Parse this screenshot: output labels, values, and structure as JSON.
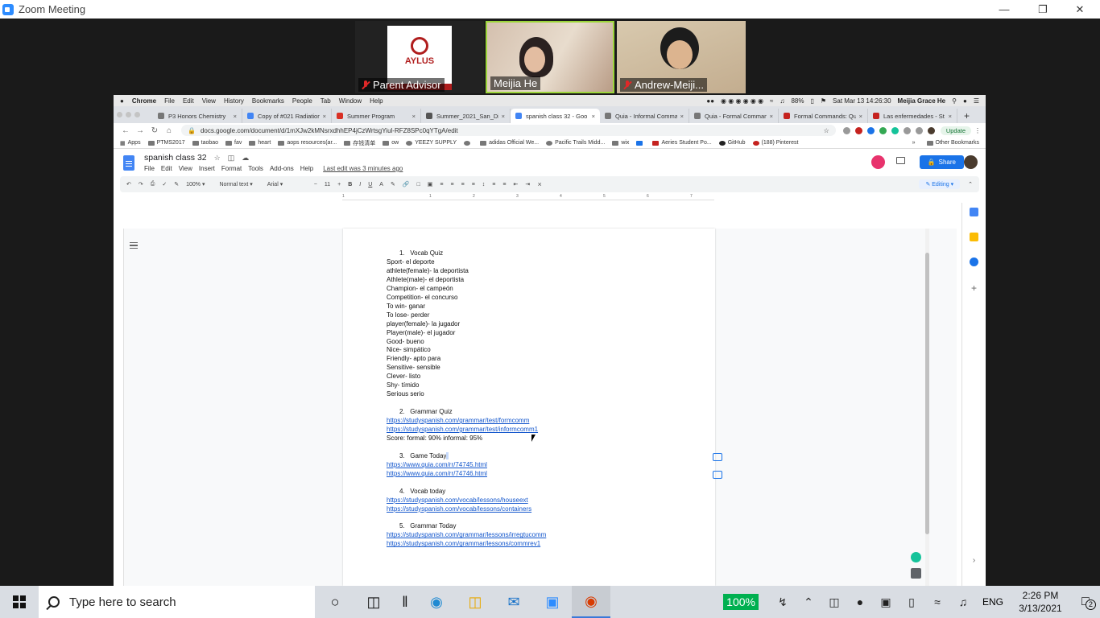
{
  "zoom": {
    "window_title": "Zoom Meeting",
    "participants": [
      {
        "name": "Parent Advisor",
        "muted": true,
        "tile_color": "#b01d1d"
      },
      {
        "name": "Meijia He",
        "muted": false,
        "tile_color": "#d4c0ae"
      },
      {
        "name": "Andrew-Meiji...",
        "muted": true,
        "tile_color": "#cdbb9e"
      }
    ],
    "parent_advisor_logo_text": "AYLUS",
    "active_speaker_border": "#9cd63a"
  },
  "mac_menu": {
    "apple": "",
    "items": [
      "Chrome",
      "File",
      "Edit",
      "View",
      "History",
      "Bookmarks",
      "People",
      "Tab",
      "Window",
      "Help"
    ],
    "battery": "88%",
    "datetime": "Sat Mar 13  14:26:30",
    "user": "Meijia Grace He"
  },
  "browser": {
    "tabs": [
      {
        "label": "P3 Honors Chemistry",
        "active": false
      },
      {
        "label": "Copy of #021 Radiation",
        "active": false
      },
      {
        "label": "Summer Program",
        "active": false
      },
      {
        "label": "Summer_2021_San_Die",
        "active": false
      },
      {
        "label": "spanish class 32 - Goo",
        "active": true
      },
      {
        "label": "Quia - Informal Comma",
        "active": false
      },
      {
        "label": "Quia - Formal Comman",
        "active": false
      },
      {
        "label": "Formal Commands: Qu",
        "active": false
      },
      {
        "label": "Las enfermedades - St",
        "active": false
      }
    ],
    "new_tab": "+",
    "url": "docs.google.com/document/d/1mXJw2kMNsrxdhhEP4jCzWrtsgYiul-RFZ8SPc0qYTgA/edit",
    "update_label": "Update",
    "bookmarks": [
      "Apps",
      "PTMS2017",
      "taobao",
      "fav",
      "heart",
      "aops resources(ar...",
      "存钱清单",
      "ow",
      "YEEZY SUPPLY",
      "adidas Official We...",
      "Pacific Trails Midd...",
      "wix",
      "Aeries Student Po...",
      "GitHub",
      "(188) Pinterest"
    ],
    "bookmarks_more": "»",
    "other_bookmarks": "Other Bookmarks"
  },
  "docs": {
    "title": "spanish class 32",
    "menu": [
      "File",
      "Edit",
      "View",
      "Insert",
      "Format",
      "Tools",
      "Add-ons",
      "Help"
    ],
    "last_edit": "Last edit was 3 minutes ago",
    "share_label": "Share",
    "toolbar": {
      "zoom": "100%",
      "style": "Normal text",
      "font": "Arial",
      "font_size": "11",
      "mode": "Editing"
    },
    "ruler_ticks": [
      "1",
      "1",
      "2",
      "3",
      "4",
      "5",
      "6",
      "7"
    ],
    "content": {
      "s1_num": "1.",
      "s1_title": "Vocab Quiz",
      "vocab": [
        "Sport- el deporte",
        "athlete(female)- la deportista",
        "Athlete(male)- el deportista",
        "Champion- el campeón",
        "Competition- el concurso",
        "To win- ganar",
        "To lose- perder",
        "player(female)- la jugador",
        "Player(male)- el jugador",
        "Good- bueno",
        "Nice- simpático",
        "Friendly- apto para",
        "Sensitive- sensible",
        "Clever- listo",
        "Shy- tímido",
        "Serious serio"
      ],
      "s2_num": "2.",
      "s2_title": "Grammar Quiz",
      "s2_links": [
        "https://studyspanish.com/grammar/test/formcomm",
        "https://studyspanish.com/grammar/test/informcomm1"
      ],
      "score": "Score:  formal: 90% informal: 95%",
      "s3_num": "3.",
      "s3_title": "Game Today",
      "s3_links": [
        "https://www.quia.com/rr/74745.html",
        "https://www.quia.com/rr/74746.html"
      ],
      "s4_num": "4.",
      "s4_title": "Vocab today",
      "s4_links": [
        "https://studyspanish.com/vocab/lessons/houseext",
        "https://studyspanish.com/vocab/lessons/containers"
      ],
      "s5_num": "5.",
      "s5_title": "Grammar Today",
      "s5_links": [
        "https://studyspanish.com/grammar/lessons/irregtucomm",
        "https://studyspanish.com/grammar/lessons/commrev1"
      ]
    }
  },
  "taskbar": {
    "search_placeholder": "Type here to search",
    "battery_percent": "100%",
    "language": "ENG",
    "time": "2:26 PM",
    "date": "3/13/2021",
    "notification_count": "2"
  }
}
